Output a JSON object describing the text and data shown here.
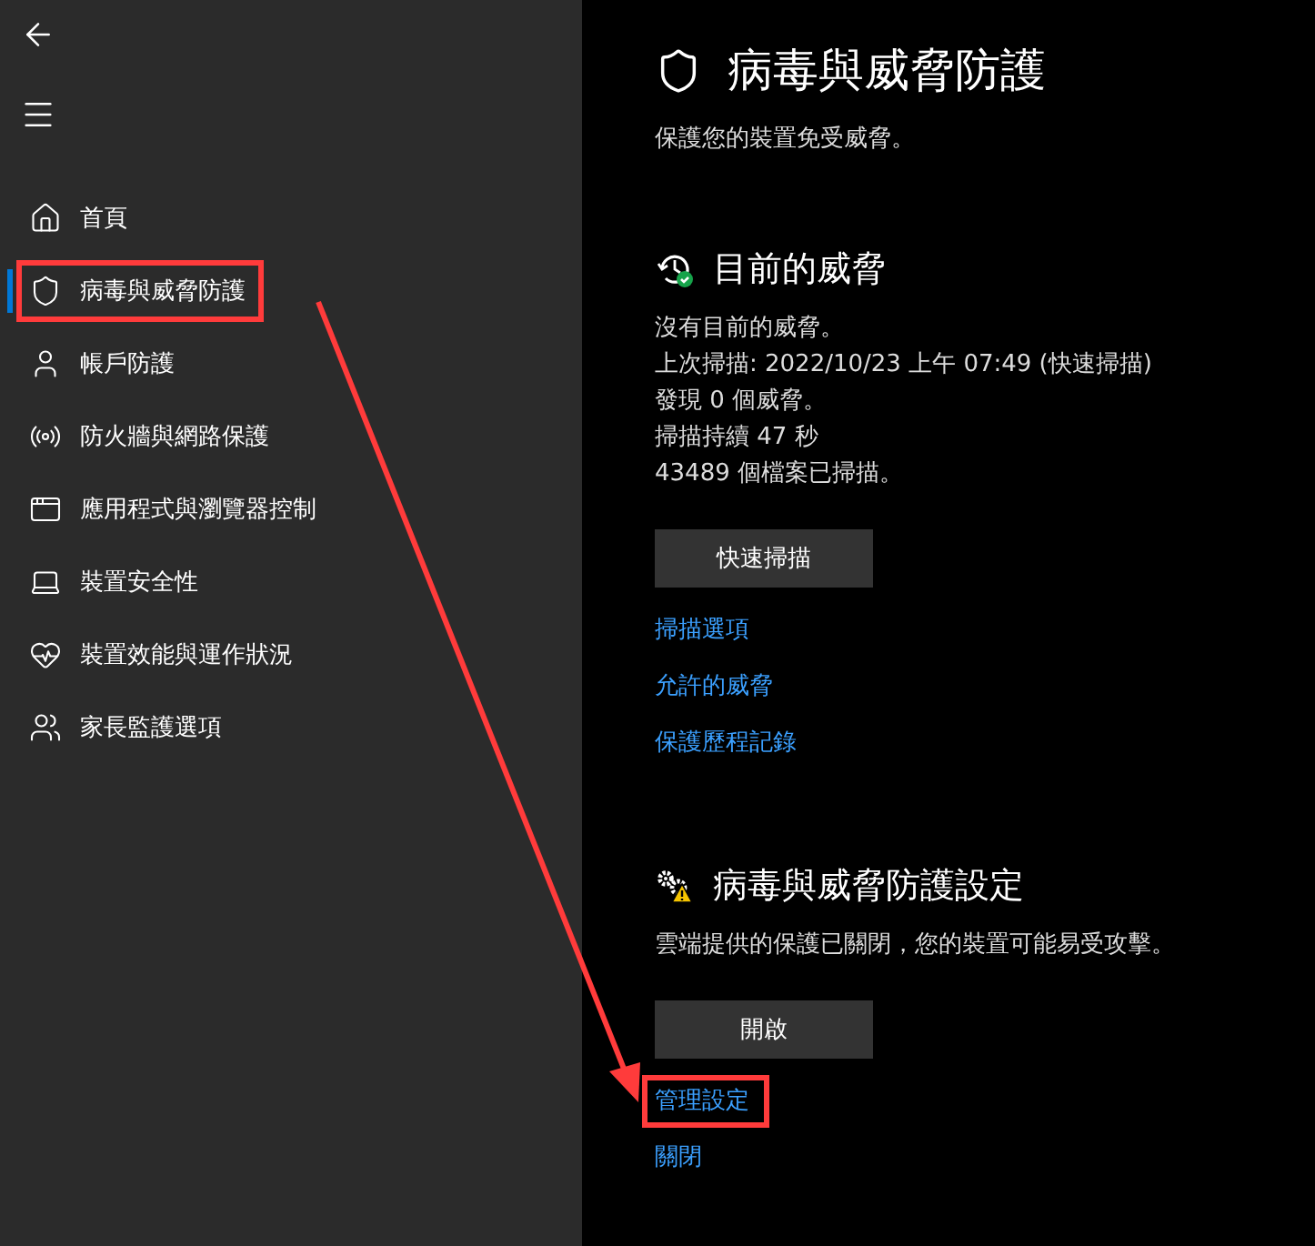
{
  "sidebar": {
    "items": [
      {
        "label": "首頁",
        "selected": false,
        "highlighted": false
      },
      {
        "label": "病毒與威脅防護",
        "selected": true,
        "highlighted": true
      },
      {
        "label": "帳戶防護",
        "selected": false,
        "highlighted": false
      },
      {
        "label": "防火牆與網路保護",
        "selected": false,
        "highlighted": false
      },
      {
        "label": "應用程式與瀏覽器控制",
        "selected": false,
        "highlighted": false
      },
      {
        "label": "裝置安全性",
        "selected": false,
        "highlighted": false
      },
      {
        "label": "裝置效能與運作狀況",
        "selected": false,
        "highlighted": false
      },
      {
        "label": "家長監護選項",
        "selected": false,
        "highlighted": false
      }
    ]
  },
  "main": {
    "title": "病毒與威脅防護",
    "subtitle": "保護您的裝置免受威脅。",
    "sections": [
      {
        "kind": "ok",
        "heading": "目前的威脅",
        "lines": [
          "沒有目前的威脅。",
          "上次掃描: 2022/10/23 上午 07:49 (快速掃描)",
          "發現 0 個威脅。",
          "掃描持續 47 秒",
          "43489 個檔案已掃描。"
        ],
        "button": "快速掃描",
        "links": [
          {
            "label": "掃描選項",
            "highlighted": false
          },
          {
            "label": "允許的威脅",
            "highlighted": false
          },
          {
            "label": "保護歷程記錄",
            "highlighted": false
          }
        ]
      },
      {
        "kind": "warning",
        "heading": "病毒與威脅防護設定",
        "lines": [
          "雲端提供的保護已關閉，您的裝置可能易受攻擊。"
        ],
        "button": "開啟",
        "links": [
          {
            "label": "管理設定",
            "highlighted": true
          },
          {
            "label": "關閉",
            "highlighted": false
          }
        ]
      }
    ]
  },
  "annotation_arrow": true
}
